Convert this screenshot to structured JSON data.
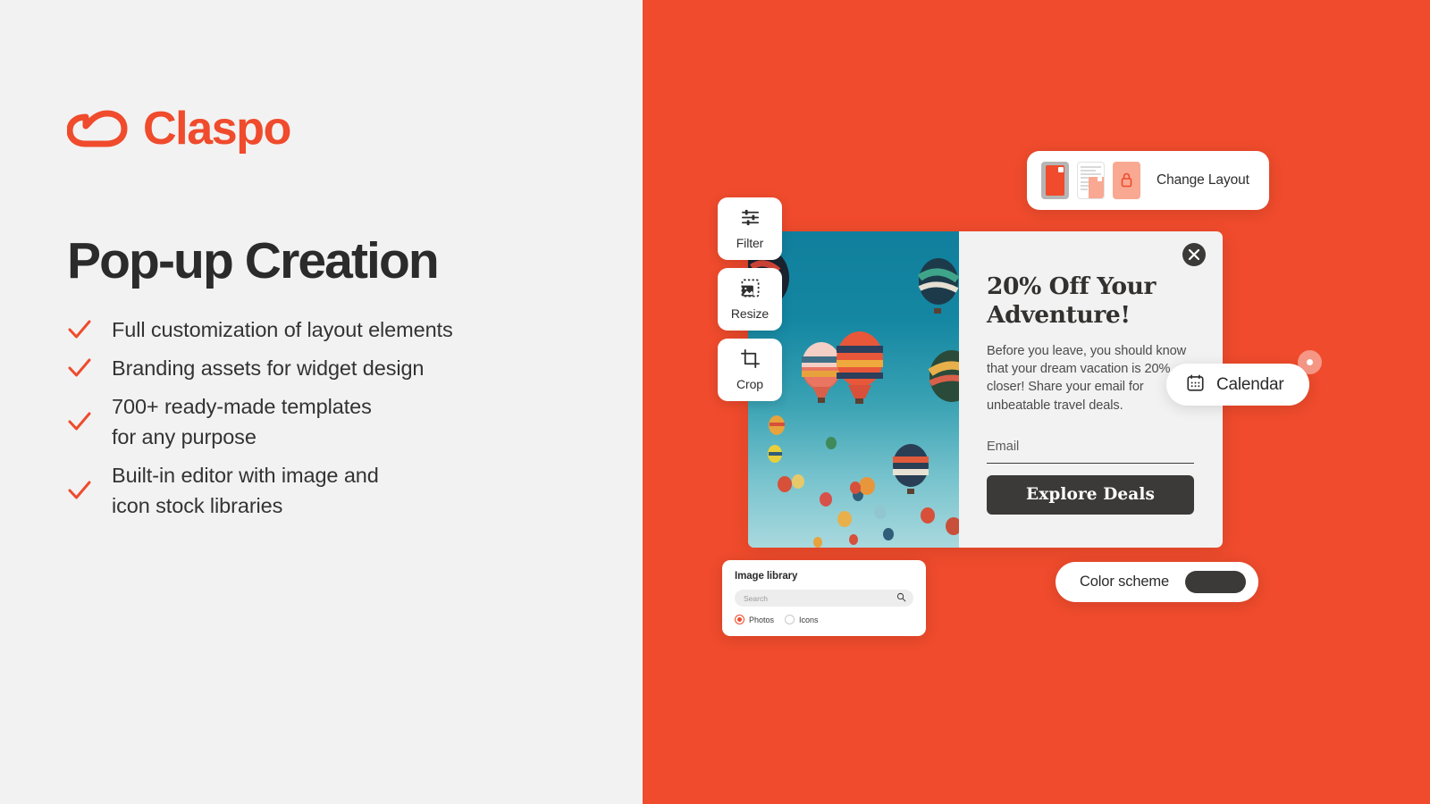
{
  "theme": {
    "brand_orange": "#ef4b2c",
    "left_bg": "#f2f2f2",
    "dark": "#3b3a38",
    "sky_top": "#107f9d",
    "sky_bottom": "#a9d9de"
  },
  "left": {
    "logo": {
      "word": "Claspo",
      "icon": "claspo-cloud-logo"
    },
    "headline": "Pop-up Creation",
    "bullets": [
      {
        "icon": "check-icon",
        "text": "Full customization of layout elements"
      },
      {
        "icon": "check-icon",
        "text": "Branding assets for widget design"
      },
      {
        "icon": "check-icon",
        "text": "700+ ready-made templates\nfor any purpose"
      },
      {
        "icon": "check-icon",
        "text": "Built-in editor with image and\nicon stock libraries"
      }
    ]
  },
  "editor": {
    "tools": [
      {
        "id": "filter",
        "label": "Filter",
        "icon": "sliders-icon"
      },
      {
        "id": "resize",
        "label": "Resize",
        "icon": "resize-image-icon"
      },
      {
        "id": "crop",
        "label": "Crop",
        "icon": "crop-icon"
      }
    ],
    "change_layout": {
      "label": "Change Layout",
      "thumbs": [
        {
          "id": "layout-centered",
          "icon": "layout-centered-thumb"
        },
        {
          "id": "layout-split",
          "icon": "layout-split-thumb"
        },
        {
          "id": "layout-locked",
          "icon": "layout-locked-thumb"
        }
      ]
    },
    "calendar_pill": {
      "label": "Calendar",
      "icon": "calendar-icon"
    },
    "color_scheme": {
      "label": "Color scheme",
      "swatch": "#3b3a38"
    },
    "image_library": {
      "title": "Image library",
      "search_placeholder": "Search",
      "search_value": "",
      "search_icon": "search-icon",
      "options": [
        {
          "label": "Photos",
          "selected": true
        },
        {
          "label": "Icons",
          "selected": false
        }
      ]
    }
  },
  "popup": {
    "title": "20% Off Your Adventure!",
    "description": "Before you leave, you should know that your dream vacation is 20% closer! Share your email for unbeatable travel deals.",
    "email_label": "Email",
    "email_value": "",
    "cta_label": "Explore Deals",
    "close_icon": "close-icon",
    "image_alt": "hot-air-balloons-photo"
  }
}
